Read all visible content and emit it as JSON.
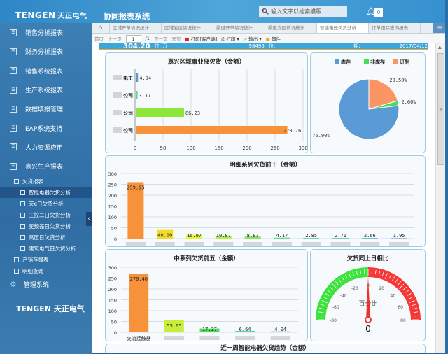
{
  "header": {
    "logo": "TENGEN",
    "logo_cn": "天正电气",
    "system_title": "协同报表系统",
    "search_placeholder": "输入文字以检索模版",
    "notification_count": "0"
  },
  "sidebar": {
    "items": [
      {
        "label": "销售分析报表"
      },
      {
        "label": "财务分析报表"
      },
      {
        "label": "销售系统报表"
      },
      {
        "label": "生产系统报表"
      },
      {
        "label": "数据填报管理"
      },
      {
        "label": "EAP系统支持"
      },
      {
        "label": "人力资源应用"
      },
      {
        "label": "嘉兴生产报表"
      }
    ],
    "group": "欠货报表",
    "subitems": [
      {
        "label": "智能电器欠货分析"
      },
      {
        "label": "天e日欠货分析"
      },
      {
        "label": "工控二日欠货分析"
      },
      {
        "label": "变频器日欠货分析"
      },
      {
        "label": "高压日欠货分析"
      },
      {
        "label": "建筑电气日欠货分析"
      }
    ],
    "more": [
      {
        "label": "产销存报表"
      },
      {
        "label": "明细查询"
      }
    ],
    "admin": "管理系统",
    "footer_logo": "TENGEN",
    "footer_logo_cn": "天正电气"
  },
  "tabs": [
    "区域开单情况统计",
    "区域发运情况统计",
    "渠道开单情况统计",
    "渠道发运情况统计",
    "智能电器欠货分析",
    "订单跟踪查询报表"
  ],
  "toolbar": {
    "first": "首页",
    "prev": "上一页",
    "page": "1",
    "total": "/1",
    "next": "下一页",
    "last": "末页",
    "print_client": "打印[客户端]",
    "print": "打印",
    "export": "输出",
    "mail": "邮件"
  },
  "summary": {
    "amount": "304.20",
    "amount_unit": "(单位: 万元)",
    "qty": "98495",
    "qty_unit": "(单位: 台)",
    "date_label": "期:",
    "date": "2017/04/12"
  },
  "colors": {
    "orange": "#f7923a",
    "blue": "#5b9bd5",
    "green": "#4cdc5c",
    "red": "#f53838"
  },
  "chart_data": [
    {
      "type": "bar",
      "orientation": "horizontal",
      "title": "嘉兴区域事业部欠货（金额）",
      "categories": [
        "电工",
        "公司",
        "公司",
        "公司"
      ],
      "values": [
        4.04,
        3.17,
        86.23,
        270.76
      ],
      "value_labels": [
        "4.04",
        "3.17",
        "86.23",
        "270.76"
      ],
      "colors": [
        "#5b9bd5",
        "#4cdc8c",
        "#8fe63b",
        "#f7923a"
      ],
      "xlim": [
        0,
        300
      ],
      "xticks": [
        "0",
        "50",
        "100",
        "150",
        "200",
        "250",
        "300"
      ]
    },
    {
      "type": "pie",
      "legend": [
        "库存",
        "非库存",
        "订制"
      ],
      "values": [
        76.9,
        2.6,
        20.5
      ],
      "labels": [
        "76.90%",
        "2.60%",
        "20.50%"
      ],
      "colors": [
        "#5b9bd5",
        "#4cdc5c",
        "#fb9563"
      ],
      "legend_position": "top"
    },
    {
      "type": "bar",
      "title": "明细系列欠货前十（金额）",
      "values": [
        259.95,
        40.0,
        16.97,
        10.87,
        8.87,
        4.17,
        2.85,
        2.71,
        2.66,
        1.95
      ],
      "value_labels": [
        "259.95",
        "40.00",
        "16.97",
        "10.87",
        "8.87",
        "4.17",
        "2.85",
        "2.71",
        "2.66",
        "1.95"
      ],
      "colors": [
        "#f7923a",
        "#f5dc2a",
        "#e2f53a",
        "#b6ef4a",
        "#8de45c",
        "#6ad88a",
        "#5fd0a8",
        "#5cc3c0",
        "#5bb0cf",
        "#5b9bd5"
      ],
      "ylim": [
        0,
        300
      ],
      "yticks": [
        "0",
        "50",
        "100",
        "150",
        "200",
        "250",
        "300"
      ]
    },
    {
      "type": "bar",
      "title": "中系列欠货前五（金额）",
      "categories": [
        "交流接触器",
        "",
        "",
        "",
        ""
      ],
      "values": [
        270.4,
        55.05,
        17.37,
        6.64,
        4.04
      ],
      "value_labels": [
        "270.40",
        "55.05",
        "17.37",
        "6.64",
        "4.04"
      ],
      "colors": [
        "#f7923a",
        "#c6ee3a",
        "#4cdc5c",
        "#4cd8b0",
        "#5b9bd5"
      ],
      "ylim": [
        0,
        300
      ],
      "yticks": [
        "0",
        "50",
        "100",
        "150",
        "200",
        "250",
        "300"
      ]
    },
    {
      "type": "gauge",
      "title": "欠货同上日相比",
      "min": -80,
      "max": 80,
      "value": 0,
      "value_label": "0",
      "unit": "百分比",
      "ticks": [
        "-80",
        "-60",
        "-40",
        "-20",
        "0",
        "20",
        "40",
        "60",
        "80"
      ]
    }
  ],
  "next_panel_title": "近一周智能电器欠货趋势（金额）"
}
